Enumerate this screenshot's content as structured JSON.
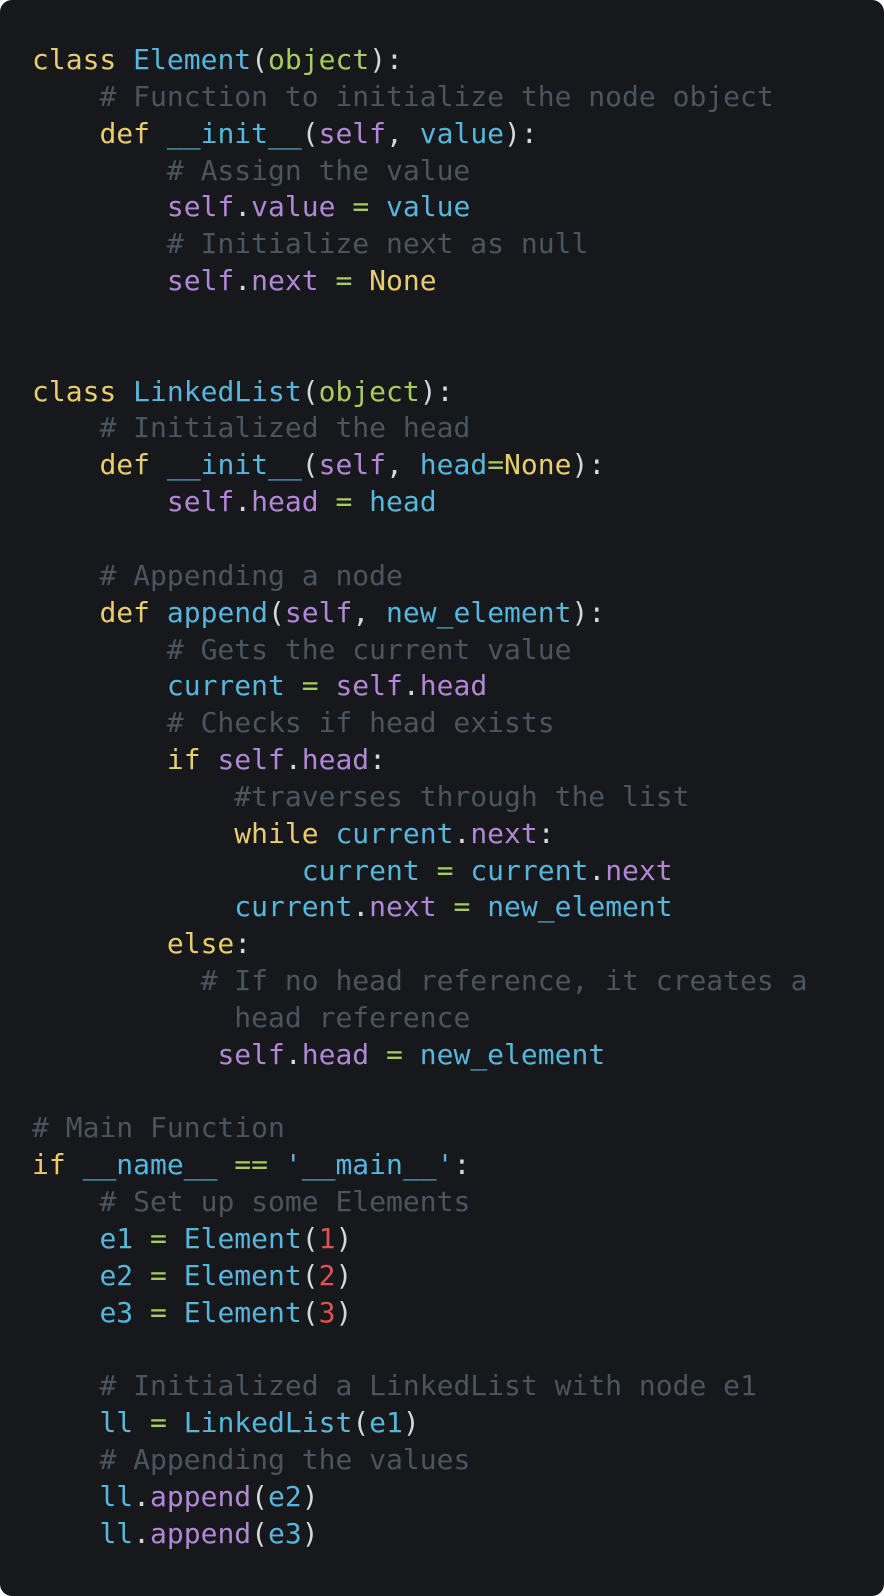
{
  "code": {
    "lines": [
      [
        [
          "kw",
          "class"
        ],
        [
          "ws",
          " "
        ],
        [
          "fn",
          "Element"
        ],
        [
          "pn",
          "("
        ],
        [
          "bi",
          "object"
        ],
        [
          "pn",
          "):"
        ]
      ],
      [
        [
          "ws",
          "    "
        ],
        [
          "cmt",
          "# Function to initialize the node object"
        ]
      ],
      [
        [
          "ws",
          "    "
        ],
        [
          "kw",
          "def"
        ],
        [
          "ws",
          " "
        ],
        [
          "fn",
          "__init__"
        ],
        [
          "pn",
          "("
        ],
        [
          "self",
          "self"
        ],
        [
          "pn",
          ", "
        ],
        [
          "id",
          "value"
        ],
        [
          "pn",
          "):"
        ]
      ],
      [
        [
          "ws",
          "        "
        ],
        [
          "cmt",
          "# Assign the value"
        ]
      ],
      [
        [
          "ws",
          "        "
        ],
        [
          "self",
          "self"
        ],
        [
          "pn",
          "."
        ],
        [
          "attr",
          "value"
        ],
        [
          "ws",
          " "
        ],
        [
          "op",
          "="
        ],
        [
          "ws",
          " "
        ],
        [
          "id",
          "value"
        ]
      ],
      [
        [
          "ws",
          "        "
        ],
        [
          "cmt",
          "# Initialize next as null"
        ]
      ],
      [
        [
          "ws",
          "        "
        ],
        [
          "self",
          "self"
        ],
        [
          "pn",
          "."
        ],
        [
          "attr",
          "next"
        ],
        [
          "ws",
          " "
        ],
        [
          "op",
          "="
        ],
        [
          "ws",
          " "
        ],
        [
          "kw",
          "None"
        ]
      ],
      [],
      [],
      [
        [
          "kw",
          "class"
        ],
        [
          "ws",
          " "
        ],
        [
          "fn",
          "LinkedList"
        ],
        [
          "pn",
          "("
        ],
        [
          "bi",
          "object"
        ],
        [
          "pn",
          "):"
        ]
      ],
      [
        [
          "ws",
          "    "
        ],
        [
          "cmt",
          "# Initialized the head"
        ]
      ],
      [
        [
          "ws",
          "    "
        ],
        [
          "kw",
          "def"
        ],
        [
          "ws",
          " "
        ],
        [
          "fn",
          "__init__"
        ],
        [
          "pn",
          "("
        ],
        [
          "self",
          "self"
        ],
        [
          "pn",
          ", "
        ],
        [
          "id",
          "head"
        ],
        [
          "op",
          "="
        ],
        [
          "kw",
          "None"
        ],
        [
          "pn",
          "):"
        ]
      ],
      [
        [
          "ws",
          "        "
        ],
        [
          "self",
          "self"
        ],
        [
          "pn",
          "."
        ],
        [
          "attr",
          "head"
        ],
        [
          "ws",
          " "
        ],
        [
          "op",
          "="
        ],
        [
          "ws",
          " "
        ],
        [
          "id",
          "head"
        ]
      ],
      [],
      [
        [
          "ws",
          "    "
        ],
        [
          "cmt",
          "# Appending a node"
        ]
      ],
      [
        [
          "ws",
          "    "
        ],
        [
          "kw",
          "def"
        ],
        [
          "ws",
          " "
        ],
        [
          "fn",
          "append"
        ],
        [
          "pn",
          "("
        ],
        [
          "self",
          "self"
        ],
        [
          "pn",
          ", "
        ],
        [
          "id",
          "new_element"
        ],
        [
          "pn",
          "):"
        ]
      ],
      [
        [
          "ws",
          "        "
        ],
        [
          "cmt",
          "# Gets the current value"
        ]
      ],
      [
        [
          "ws",
          "        "
        ],
        [
          "id",
          "current"
        ],
        [
          "ws",
          " "
        ],
        [
          "op",
          "="
        ],
        [
          "ws",
          " "
        ],
        [
          "self",
          "self"
        ],
        [
          "pn",
          "."
        ],
        [
          "attr",
          "head"
        ]
      ],
      [
        [
          "ws",
          "        "
        ],
        [
          "cmt",
          "# Checks if head exists"
        ]
      ],
      [
        [
          "ws",
          "        "
        ],
        [
          "kw",
          "if"
        ],
        [
          "ws",
          " "
        ],
        [
          "self",
          "self"
        ],
        [
          "pn",
          "."
        ],
        [
          "attr",
          "head"
        ],
        [
          "pn",
          ":"
        ]
      ],
      [
        [
          "ws",
          "            "
        ],
        [
          "cmt",
          "#traverses through the list"
        ]
      ],
      [
        [
          "ws",
          "            "
        ],
        [
          "kw",
          "while"
        ],
        [
          "ws",
          " "
        ],
        [
          "id",
          "current"
        ],
        [
          "pn",
          "."
        ],
        [
          "attr",
          "next"
        ],
        [
          "pn",
          ":"
        ]
      ],
      [
        [
          "ws",
          "                "
        ],
        [
          "id",
          "current"
        ],
        [
          "ws",
          " "
        ],
        [
          "op",
          "="
        ],
        [
          "ws",
          " "
        ],
        [
          "id",
          "current"
        ],
        [
          "pn",
          "."
        ],
        [
          "attr",
          "next"
        ]
      ],
      [
        [
          "ws",
          "            "
        ],
        [
          "id",
          "current"
        ],
        [
          "pn",
          "."
        ],
        [
          "attr",
          "next"
        ],
        [
          "ws",
          " "
        ],
        [
          "op",
          "="
        ],
        [
          "ws",
          " "
        ],
        [
          "id",
          "new_element"
        ]
      ],
      [
        [
          "ws",
          "        "
        ],
        [
          "kw",
          "else"
        ],
        [
          "pn",
          ":"
        ]
      ],
      [
        [
          "ws",
          "          "
        ],
        [
          "cmt",
          "# If no head reference, it creates a"
        ]
      ],
      [
        [
          "ws",
          "            "
        ],
        [
          "cmt",
          "head reference"
        ]
      ],
      [
        [
          "ws",
          "           "
        ],
        [
          "self",
          "self"
        ],
        [
          "pn",
          "."
        ],
        [
          "attr",
          "head"
        ],
        [
          "ws",
          " "
        ],
        [
          "op",
          "="
        ],
        [
          "ws",
          " "
        ],
        [
          "id",
          "new_element"
        ]
      ],
      [],
      [
        [
          "cmt",
          "# Main Function"
        ]
      ],
      [
        [
          "kw",
          "if"
        ],
        [
          "ws",
          " "
        ],
        [
          "id",
          "__name__"
        ],
        [
          "ws",
          " "
        ],
        [
          "op",
          "=="
        ],
        [
          "ws",
          " "
        ],
        [
          "str",
          "'__main__'"
        ],
        [
          "pn",
          ":"
        ]
      ],
      [
        [
          "ws",
          "    "
        ],
        [
          "cmt",
          "# Set up some Elements"
        ]
      ],
      [
        [
          "ws",
          "    "
        ],
        [
          "id",
          "e1"
        ],
        [
          "ws",
          " "
        ],
        [
          "op",
          "="
        ],
        [
          "ws",
          " "
        ],
        [
          "fn",
          "Element"
        ],
        [
          "pn",
          "("
        ],
        [
          "num",
          "1"
        ],
        [
          "pn",
          ")"
        ]
      ],
      [
        [
          "ws",
          "    "
        ],
        [
          "id",
          "e2"
        ],
        [
          "ws",
          " "
        ],
        [
          "op",
          "="
        ],
        [
          "ws",
          " "
        ],
        [
          "fn",
          "Element"
        ],
        [
          "pn",
          "("
        ],
        [
          "num",
          "2"
        ],
        [
          "pn",
          ")"
        ]
      ],
      [
        [
          "ws",
          "    "
        ],
        [
          "id",
          "e3"
        ],
        [
          "ws",
          " "
        ],
        [
          "op",
          "="
        ],
        [
          "ws",
          " "
        ],
        [
          "fn",
          "Element"
        ],
        [
          "pn",
          "("
        ],
        [
          "num",
          "3"
        ],
        [
          "pn",
          ")"
        ]
      ],
      [],
      [
        [
          "ws",
          "    "
        ],
        [
          "cmt",
          "# Initialized a LinkedList with node e1"
        ]
      ],
      [
        [
          "ws",
          "    "
        ],
        [
          "id",
          "ll"
        ],
        [
          "ws",
          " "
        ],
        [
          "op",
          "="
        ],
        [
          "ws",
          " "
        ],
        [
          "fn",
          "LinkedList"
        ],
        [
          "pn",
          "("
        ],
        [
          "id",
          "e1"
        ],
        [
          "pn",
          ")"
        ]
      ],
      [
        [
          "ws",
          "    "
        ],
        [
          "cmt",
          "# Appending the values"
        ]
      ],
      [
        [
          "ws",
          "    "
        ],
        [
          "id",
          "ll"
        ],
        [
          "pn",
          "."
        ],
        [
          "attr",
          "append"
        ],
        [
          "pn",
          "("
        ],
        [
          "id",
          "e2"
        ],
        [
          "pn",
          ")"
        ]
      ],
      [
        [
          "ws",
          "    "
        ],
        [
          "id",
          "ll"
        ],
        [
          "pn",
          "."
        ],
        [
          "attr",
          "append"
        ],
        [
          "pn",
          "("
        ],
        [
          "id",
          "e3"
        ],
        [
          "pn",
          ")"
        ]
      ]
    ]
  },
  "colors": {
    "background": "#16181b",
    "keyword": "#e8cd6f",
    "identifier": "#56b6dc",
    "self": "#b287d6",
    "builtin": "#a7cc5e",
    "number": "#e05252",
    "comment": "#4a5560",
    "punctuation": "#d4d7dc"
  }
}
